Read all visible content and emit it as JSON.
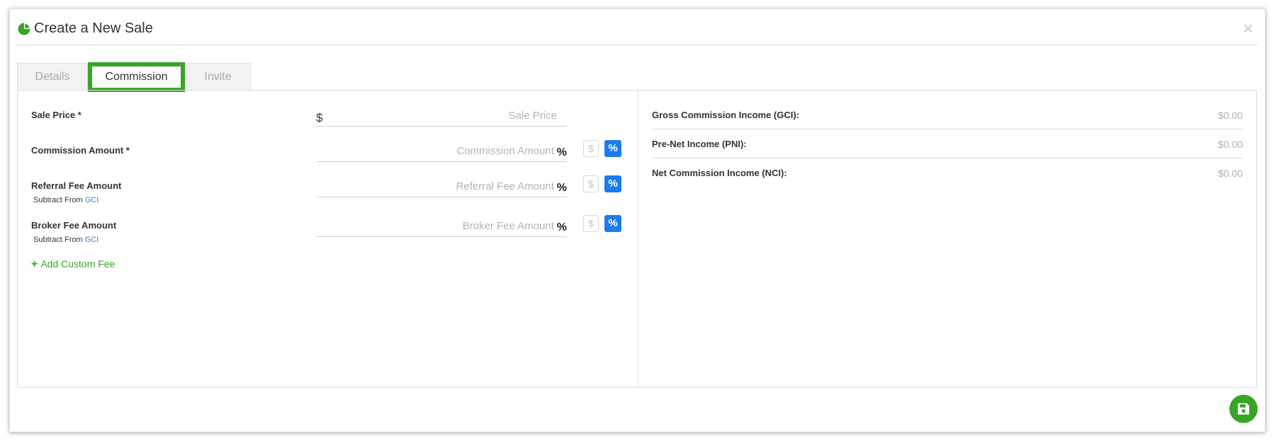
{
  "modal": {
    "title": "Create a New Sale",
    "close_label": "×"
  },
  "tabs": [
    {
      "label": "Details"
    },
    {
      "label": "Commission"
    },
    {
      "label": "Invite"
    }
  ],
  "form": {
    "sale_price": {
      "label": "Sale Price *",
      "prefix": "$",
      "placeholder": "Sale Price",
      "value": ""
    },
    "commission": {
      "label": "Commission Amount *",
      "placeholder": "Commission Amount",
      "suffix": "%",
      "value": ""
    },
    "referral": {
      "label": "Referral Fee Amount",
      "placeholder": "Referral Fee Amount",
      "suffix": "%",
      "value": "",
      "subtract_text": "Subtract From",
      "subtract_link": "GCI"
    },
    "broker": {
      "label": "Broker Fee Amount",
      "placeholder": "Broker Fee Amount",
      "suffix": "%",
      "value": "",
      "subtract_text": "Subtract From",
      "subtract_link": "GCI"
    },
    "toggle": {
      "dollar": "$",
      "percent": "%"
    },
    "add_custom_fee": {
      "plus": "+",
      "label": "Add Custom Fee"
    }
  },
  "summary": [
    {
      "label": "Gross Commission Income (GCI):",
      "value": "$0.00"
    },
    {
      "label": "Pre-Net Income (PNI):",
      "value": "$0.00"
    },
    {
      "label": "Net Commission Income (NCI):",
      "value": "$0.00"
    }
  ],
  "colors": {
    "accent_green": "#3aa428",
    "toggle_blue": "#1a7cf0",
    "link_blue": "#2a7ae2"
  },
  "icons": {
    "logo": "pie-chart-icon",
    "close": "close-icon",
    "add": "plus-icon",
    "save": "floppy-disk-icon"
  }
}
